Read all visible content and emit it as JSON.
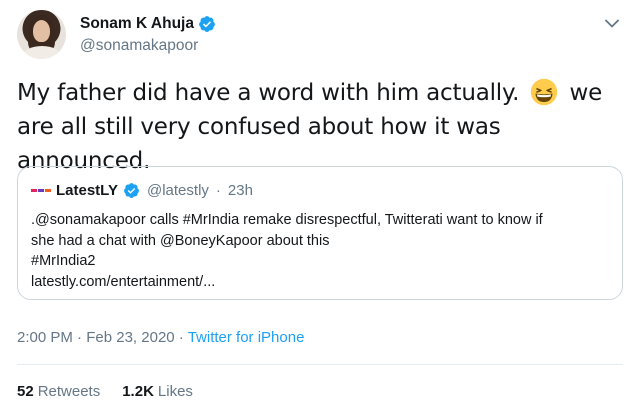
{
  "author": {
    "display_name": "Sonam K Ahuja",
    "handle": "@sonamakapoor",
    "verified_icon": "verified-badge-icon",
    "avatar_icon": "profile-photo"
  },
  "tweet": {
    "text_part1": "My father did have a word with him actually.",
    "emoji": "grinning-squinting-face-emoji",
    "text_part2": "we are all still very confused about how it was announced."
  },
  "quoted_tweet": {
    "logo_text": "LatestLY",
    "display_name": "LatestLY",
    "handle": "@latestly",
    "separator": "·",
    "time": "23h",
    "body_line1": ".@sonamakapoor calls #MrIndia remake disrespectful, Twitterati want to know if",
    "body_line2": "she had a chat with @BoneyKapoor about this",
    "body_line3": "#MrIndia2",
    "body_line4": "latestly.com/entertainment/..."
  },
  "meta": {
    "time": "2:00 PM",
    "separator": "·",
    "date": "Feb 23, 2020",
    "source": "Twitter for iPhone"
  },
  "stats": {
    "retweets_count": "52",
    "retweets_label": "Retweets",
    "likes_count": "1.2K",
    "likes_label": "Likes"
  },
  "colors": {
    "accent": "#1da1f2",
    "secondary_text": "#657786",
    "border": "#ccd6dd"
  }
}
